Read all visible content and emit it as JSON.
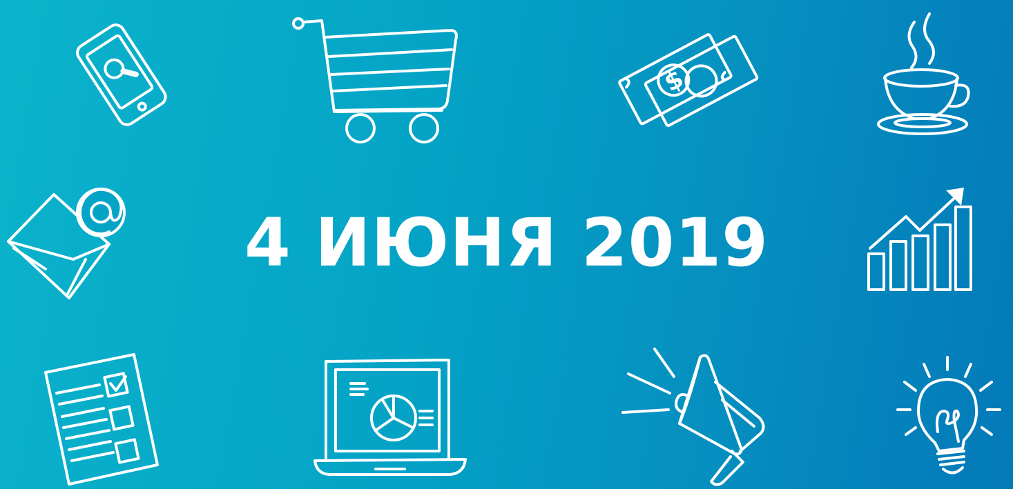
{
  "headline": {
    "date_text": "4 ИЮНЯ 2019"
  },
  "colors": {
    "background_start": "#0bb3cb",
    "background_end": "#0479b8",
    "foreground": "#ffffff"
  },
  "icons": [
    "smartphone-search-icon",
    "shopping-cart-icon",
    "money-bills-icon",
    "coffee-cup-icon",
    "email-at-icon",
    "growth-chart-icon",
    "checklist-document-icon",
    "laptop-chart-icon",
    "megaphone-icon",
    "light-bulb-icon"
  ]
}
